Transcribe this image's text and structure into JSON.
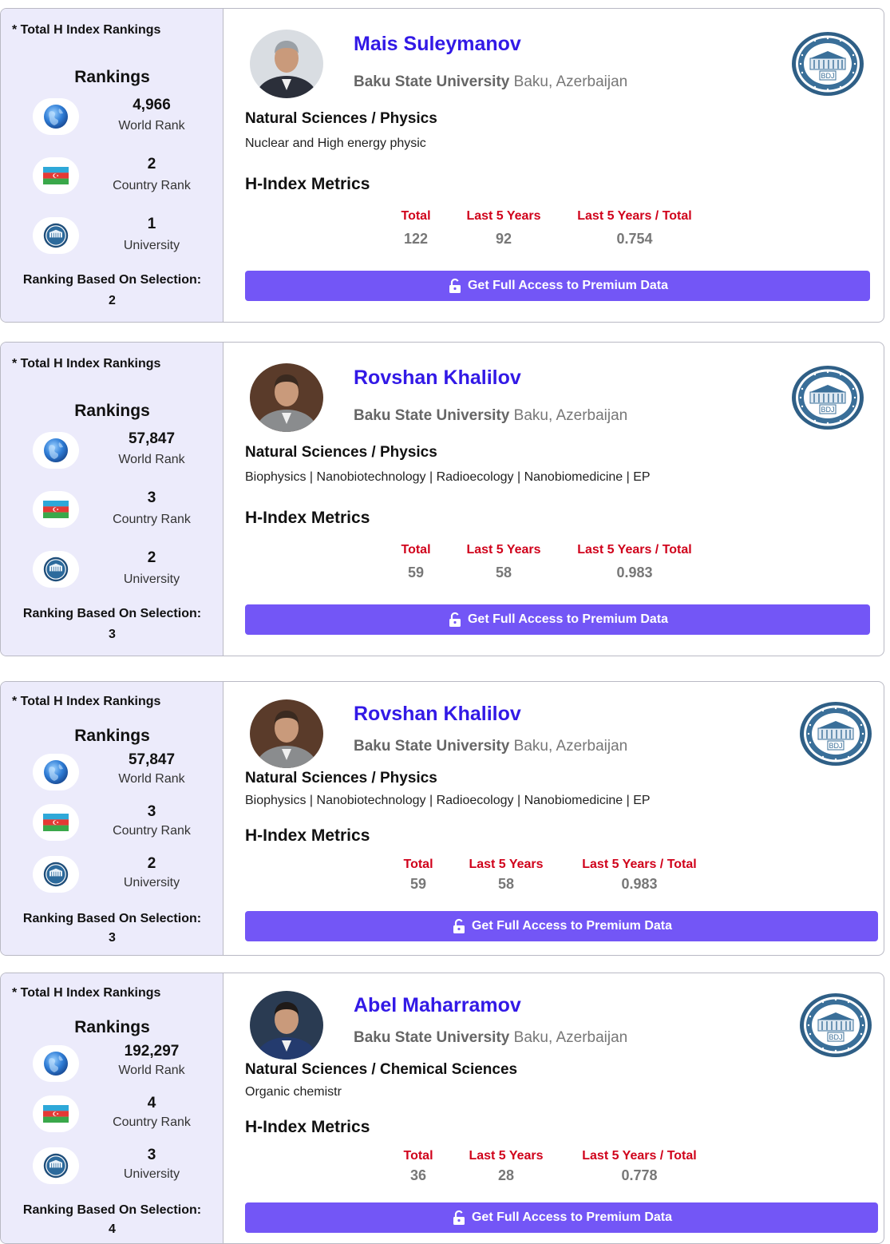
{
  "common": {
    "rankings_header": "* Total H Index Rankings",
    "rankings_title": "Rankings",
    "world_rank_label": "World Rank",
    "country_rank_label": "Country Rank",
    "university_rank_label": "University",
    "selection_label": "Ranking Based On Selection:",
    "metrics_title": "H-Index Metrics",
    "metric_total_label": "Total",
    "metric_last5_label": "Last 5 Years",
    "metric_ratio_label": "Last 5 Years / Total",
    "access_button_label": "Get Full Access to Premium Data",
    "university_logo_text": "BDJ",
    "icons": {
      "world": "globe-icon",
      "country": "azerbaijan-flag-icon",
      "university": "university-seal-icon",
      "button": "unlock-icon"
    },
    "colors": {
      "accent": "#7356f6",
      "name": "#3219e6",
      "metric_label": "#d0021b",
      "sidebar_bg": "#ecebfb"
    }
  },
  "cards": [
    {
      "name": "Mais Suleymanov",
      "university": "Baku State University",
      "location": "Baku, Azerbaijan",
      "field": "Natural Sciences / Physics",
      "keywords": "Nuclear and High energy physic",
      "world_rank": "4,966",
      "country_rank": "2",
      "university_rank": "1",
      "selection_rank": "2",
      "metric_total": "122",
      "metric_last5": "92",
      "metric_ratio": "0.754"
    },
    {
      "name": "Rovshan Khalilov",
      "university": "Baku State University",
      "location": "Baku, Azerbaijan",
      "field": "Natural Sciences / Physics",
      "keywords": "Biophysics | Nanobiotechnology | Radioecology | Nanobiomedicine | EP",
      "world_rank": "57,847",
      "country_rank": "3",
      "university_rank": "2",
      "selection_rank": "3",
      "metric_total": "59",
      "metric_last5": "58",
      "metric_ratio": "0.983"
    },
    {
      "name": "Rovshan Khalilov",
      "university": "Baku State University",
      "location": "Baku, Azerbaijan",
      "field": "Natural Sciences / Physics",
      "keywords": "Biophysics | Nanobiotechnology | Radioecology | Nanobiomedicine | EP",
      "world_rank": "57,847",
      "country_rank": "3",
      "university_rank": "2",
      "selection_rank": "3",
      "metric_total": "59",
      "metric_last5": "58",
      "metric_ratio": "0.983"
    },
    {
      "name": "Abel Maharramov",
      "university": "Baku State University",
      "location": "Baku, Azerbaijan",
      "field": "Natural Sciences / Chemical Sciences",
      "keywords": "Organic chemistr",
      "world_rank": "192,297",
      "country_rank": "4",
      "university_rank": "3",
      "selection_rank": "4",
      "metric_total": "36",
      "metric_last5": "28",
      "metric_ratio": "0.778"
    }
  ]
}
